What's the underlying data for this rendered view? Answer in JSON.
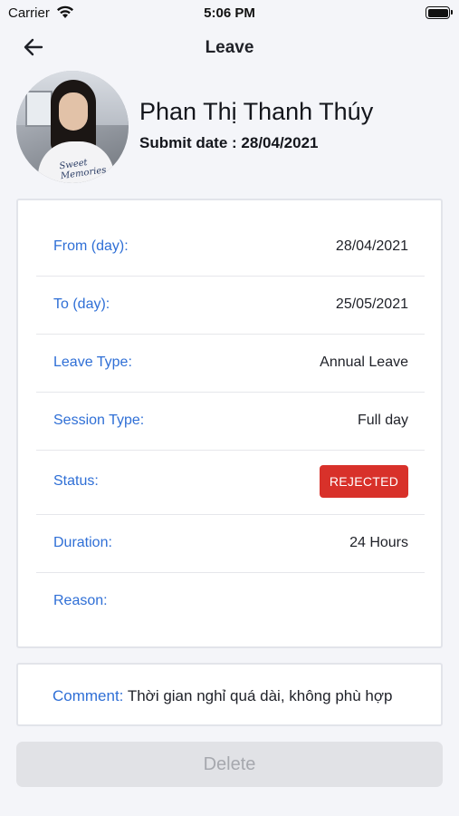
{
  "status_bar": {
    "carrier": "Carrier",
    "time": "5:06 PM"
  },
  "nav": {
    "title": "Leave",
    "back_icon": "arrow-left-icon"
  },
  "profile": {
    "name": "Phan Thị Thanh Thúy",
    "submit_label": "Submit date : ",
    "submit_date": "28/04/2021",
    "shirt_text": "Sweet Memories"
  },
  "details": {
    "from_label": "From (day):",
    "from_value": "28/04/2021",
    "to_label": "To (day):",
    "to_value": "25/05/2021",
    "leave_type_label": "Leave Type:",
    "leave_type_value": "Annual Leave",
    "session_type_label": "Session Type:",
    "session_type_value": "Full day",
    "status_label": "Status:",
    "status_value": "REJECTED",
    "duration_label": "Duration:",
    "duration_value": "24 Hours",
    "reason_label": "Reason:",
    "reason_value": ""
  },
  "comment": {
    "label": "Comment:",
    "value": " Thời gian nghỉ quá dài, không phù hợp"
  },
  "actions": {
    "delete_label": "Delete"
  },
  "colors": {
    "accent": "#2f6fd6",
    "rejected": "#d8312a",
    "background": "#f4f5f9",
    "disabled_button": "#e1e2e6"
  }
}
